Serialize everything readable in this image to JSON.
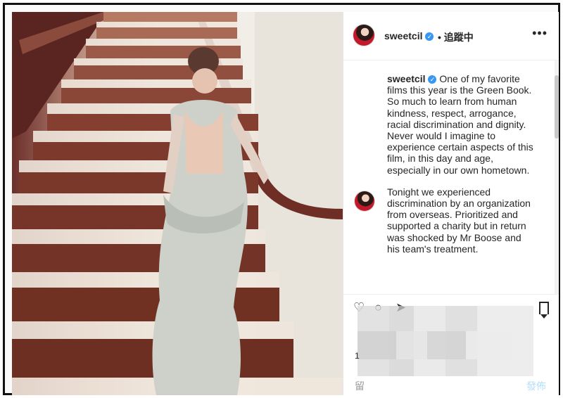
{
  "post": {
    "username": "sweetcil",
    "follow_status": "• 追蹤中",
    "more_icon": "more-horizontal-icon",
    "caption_username": "sweetcil",
    "caption_para1": "One of my favorite films this year is the Green Book. So much to learn from human kindness, respect, arrogance, racial discrimination and dignity. Never would I imagine to experience certain aspects of this film, in this day and age, especially in our own hometown.",
    "caption_para2": "Tonight we experienced discrimination by an organization from overseas. Prioritized and supported a charity but in return was shocked by Mr Boose and his team's treatment."
  },
  "actions": {
    "likes_partial": "1",
    "comment_partial": "留",
    "post_partial": "發佈"
  },
  "colors": {
    "verified": "#3897f0",
    "dress": "#c9cfc6",
    "carpet": "#7d3a2c"
  }
}
